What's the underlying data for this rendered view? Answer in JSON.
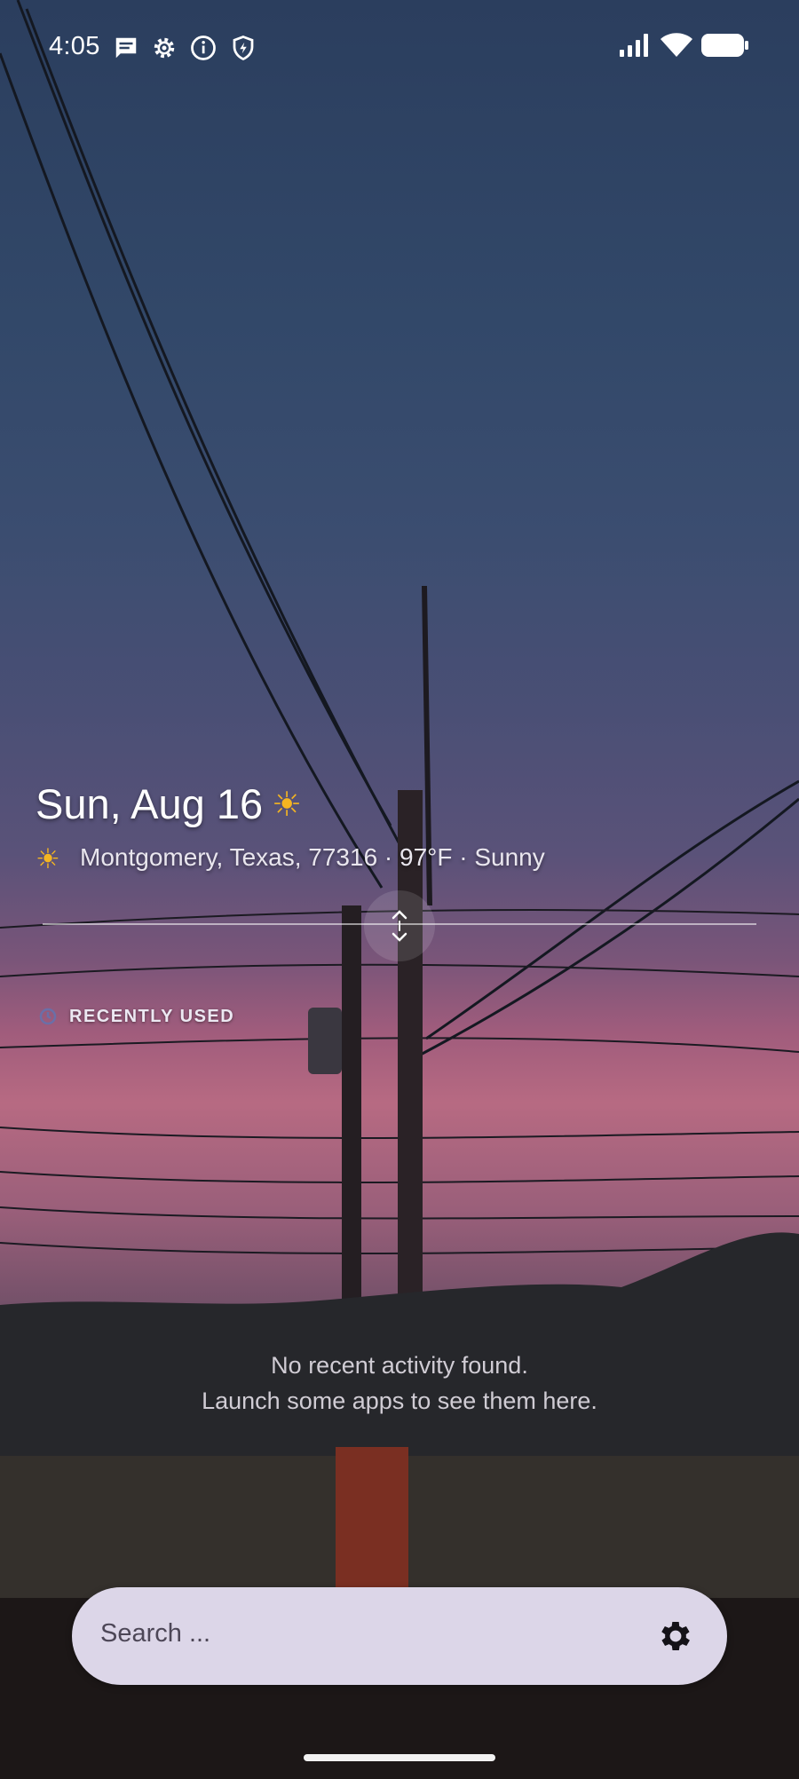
{
  "status_bar": {
    "time": "4:05",
    "left_icons": [
      "message-icon",
      "settings-icon",
      "info-icon",
      "shield-icon"
    ],
    "right_icons": [
      "signal-icon",
      "wifi-icon",
      "battery-icon"
    ]
  },
  "header": {
    "date": "Sun, Aug 16",
    "date_icon": "sun-icon",
    "weather_icon": "sun-icon",
    "weather_text": "Montgomery, Texas, 77316 · 97°F · Sunny"
  },
  "recent": {
    "section_label": "RECENTLY USED",
    "empty_line1": "No recent activity found.",
    "empty_line2": "Launch some apps to see them here."
  },
  "search": {
    "placeholder": "Search ...",
    "settings_icon": "gear-icon"
  },
  "colors": {
    "accent_sun": "#f5b521",
    "search_bg": "#dcd6e8"
  }
}
